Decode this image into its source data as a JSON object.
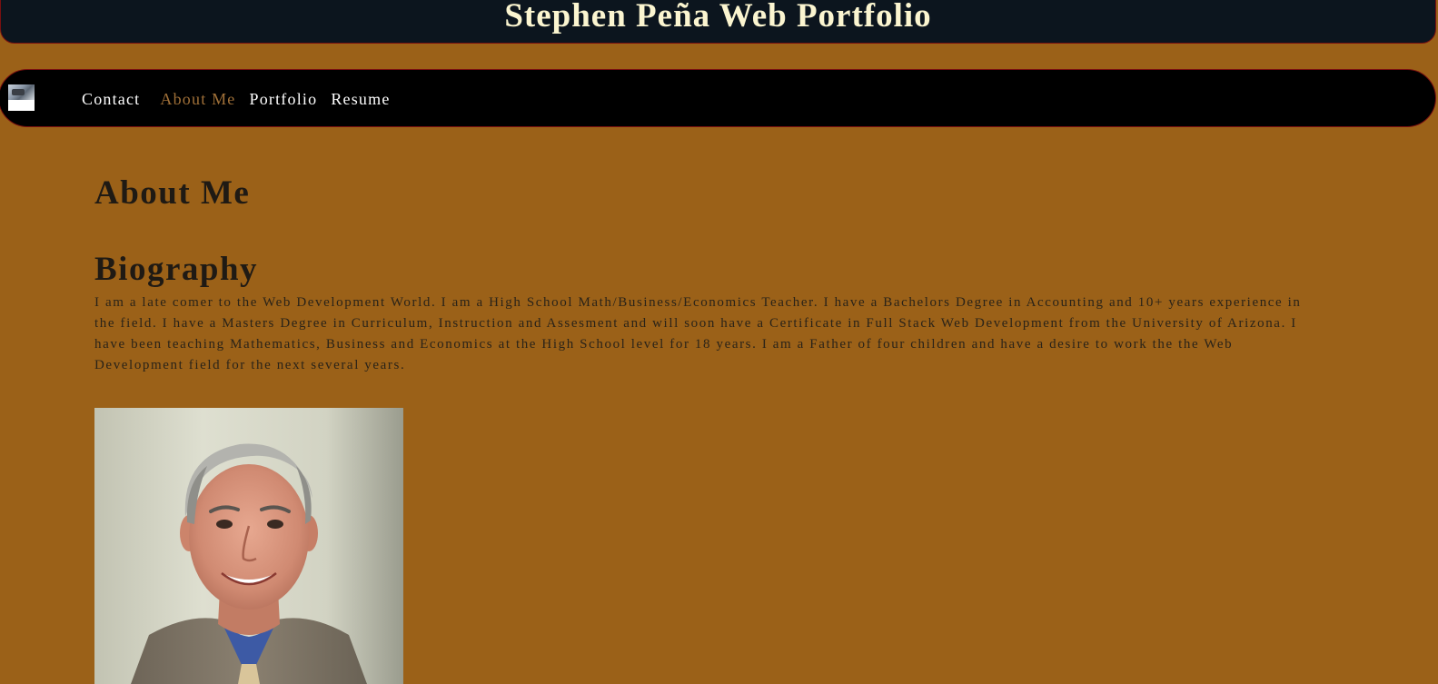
{
  "header": {
    "title": "Stephen Peña Web Portfolio"
  },
  "nav": {
    "logo_icon": "profile-thumbnail",
    "links": [
      {
        "label": "Contact",
        "active": false
      },
      {
        "label": "About Me",
        "active": true
      },
      {
        "label": "Portfolio",
        "active": false
      },
      {
        "label": "Resume",
        "active": false
      }
    ]
  },
  "main": {
    "heading": "About Me",
    "bio_heading": "Biography",
    "bio_text": "I am a late comer to the Web Development World. I am a High School Math/Business/Economics Teacher. I have a Bachelors Degree in Accounting and 10+ years experience in the field. I have a Masters Degree in Curriculum, Instruction and Assesment and will soon have a Certificate in Full Stack Web Development from the University of Arizona. I have been teaching Mathematics, Business and Economics at the High School level for 18 years. I am a Father of four children and have a desire to work the the Web Development field for the next several years."
  },
  "colors": {
    "page_background": "#9b6118",
    "header_background": "#0c151e",
    "nav_background": "#000000",
    "title_color": "#fbf5d0",
    "active_link": "#a07038",
    "border_accent": "#7a1010"
  }
}
